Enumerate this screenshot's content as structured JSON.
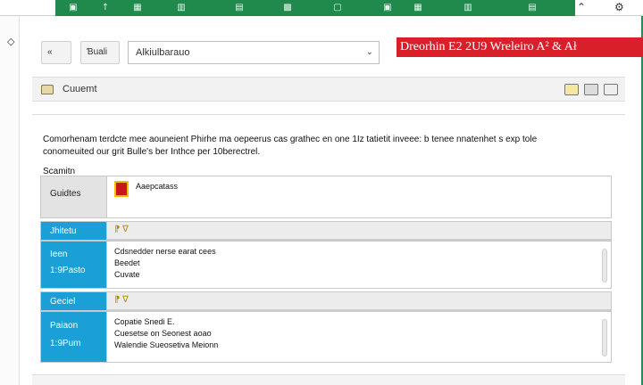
{
  "window": {
    "minimize_glyph": "⌃",
    "settings_glyph": "⚙",
    "rail_glyph": "◇"
  },
  "ribbon": {
    "icons": [
      "▣",
      "↑",
      "▦",
      "▥",
      "▤",
      "▩",
      "▢",
      "▣",
      "▦",
      "▥",
      "▤"
    ]
  },
  "toolbar": {
    "back_label": "«",
    "mark_label": "Ɓuali",
    "dropdown_value": "Alkiulbarauo",
    "dropdown_caret": "⌄"
  },
  "banner": {
    "text": "Dreorhin E2 2U9 Wreleiro A² & Ał"
  },
  "panel": {
    "title": "Cuuemt"
  },
  "content": {
    "description_line1": "Comorhenam terdcte mee aouneient Phirhe ma oepeerus cas grathec en one 1Iz tatietit inveee: b tenee nnatenhet s exp tole",
    "description_line2": "conomeuited our grit Bulle's ber Inthce per 10berectrel.",
    "section_label": "Scamitn",
    "rows": [
      {
        "left": "Guidtes",
        "right": "Aaepcatass",
        "blue": false
      },
      {
        "left": "Jhitetu",
        "right": "",
        "blue": true
      },
      {
        "left": "Ieen\n1:9Pasto",
        "right_lines": [
          "Cdsnedder nerse earat cees",
          "Beedet",
          "Cuvate"
        ],
        "blue": true
      },
      {
        "left": "Geciel",
        "right": "",
        "blue": true
      },
      {
        "left": "Paiaon\n1:9Pum",
        "right_lines": [
          "Copatie Snedi E.",
          "Cuesetse on Seonest aoao",
          "Walendie Sueosetiva Meionn"
        ],
        "blue": true
      }
    ],
    "marker_glyph": "⁋ ∇"
  }
}
